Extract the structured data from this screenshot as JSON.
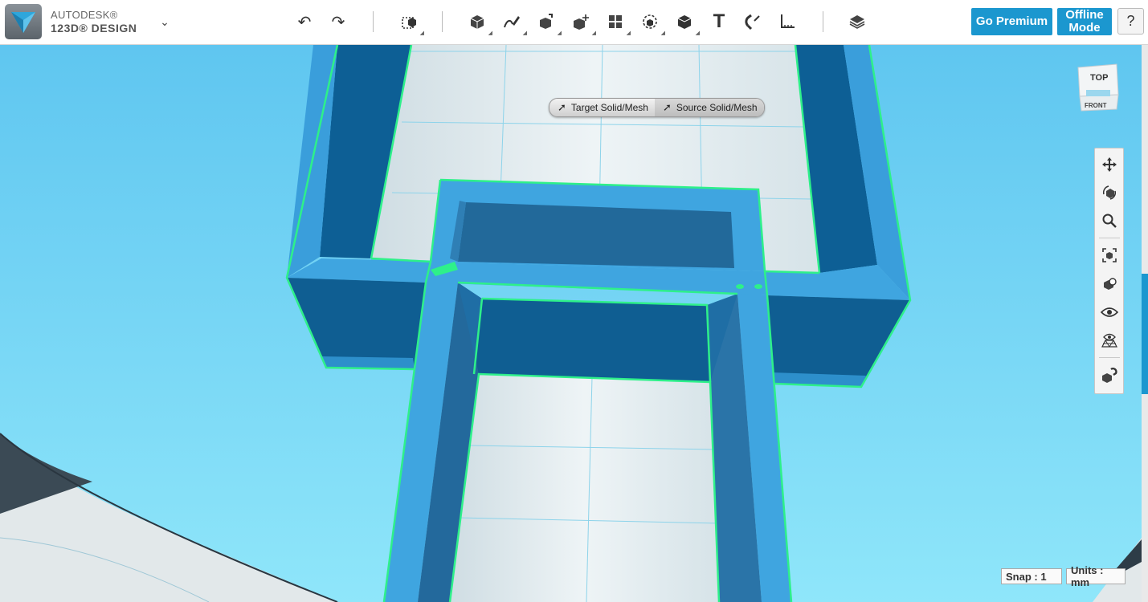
{
  "app": {
    "brand_line1": "AUTODESK®",
    "brand_line2": "123D® DESIGN",
    "menu_icon": "chevron-down-icon"
  },
  "toolbar": {
    "tools": [
      {
        "name": "undo-icon",
        "glyph": "↶"
      },
      {
        "name": "redo-icon",
        "glyph": "↷"
      },
      {
        "name": "transform-icon",
        "glyph": "⬚"
      },
      {
        "name": "primitives-icon",
        "glyph": "◧"
      },
      {
        "name": "sketch-icon",
        "glyph": "✎"
      },
      {
        "name": "construct-icon",
        "glyph": "◨"
      },
      {
        "name": "modify-icon",
        "glyph": "◩"
      },
      {
        "name": "pattern-icon",
        "glyph": "▦"
      },
      {
        "name": "grouping-icon",
        "glyph": "◌"
      },
      {
        "name": "combine-icon",
        "glyph": "◼"
      },
      {
        "name": "text-icon",
        "glyph": "T"
      },
      {
        "name": "snap-icon",
        "glyph": "∩"
      },
      {
        "name": "measure-icon",
        "glyph": "∟"
      },
      {
        "name": "material-icon",
        "glyph": "≋"
      }
    ],
    "go_premium": "Go Premium",
    "offline_mode": "Offline Mode",
    "help": "?"
  },
  "selection_bar": {
    "target": "Target Solid/Mesh",
    "source": "Source Solid/Mesh"
  },
  "viewcube": {
    "top": "TOP",
    "front": "FRONT"
  },
  "navbar": {
    "items": [
      "pan-icon",
      "orbit-icon",
      "zoom-icon",
      "fit-icon",
      "view-icon",
      "visibility-icon",
      "material-view-icon",
      "snap-to-icon"
    ]
  },
  "status": {
    "snap": "Snap : 1",
    "units": "Units : mm"
  },
  "colors": {
    "accent": "#1b97cf",
    "sky": "#5cc3ee",
    "solid_light": "#3fa3dc",
    "solid_dark": "#0f5f93",
    "selection_outline": "#2ef08a"
  }
}
